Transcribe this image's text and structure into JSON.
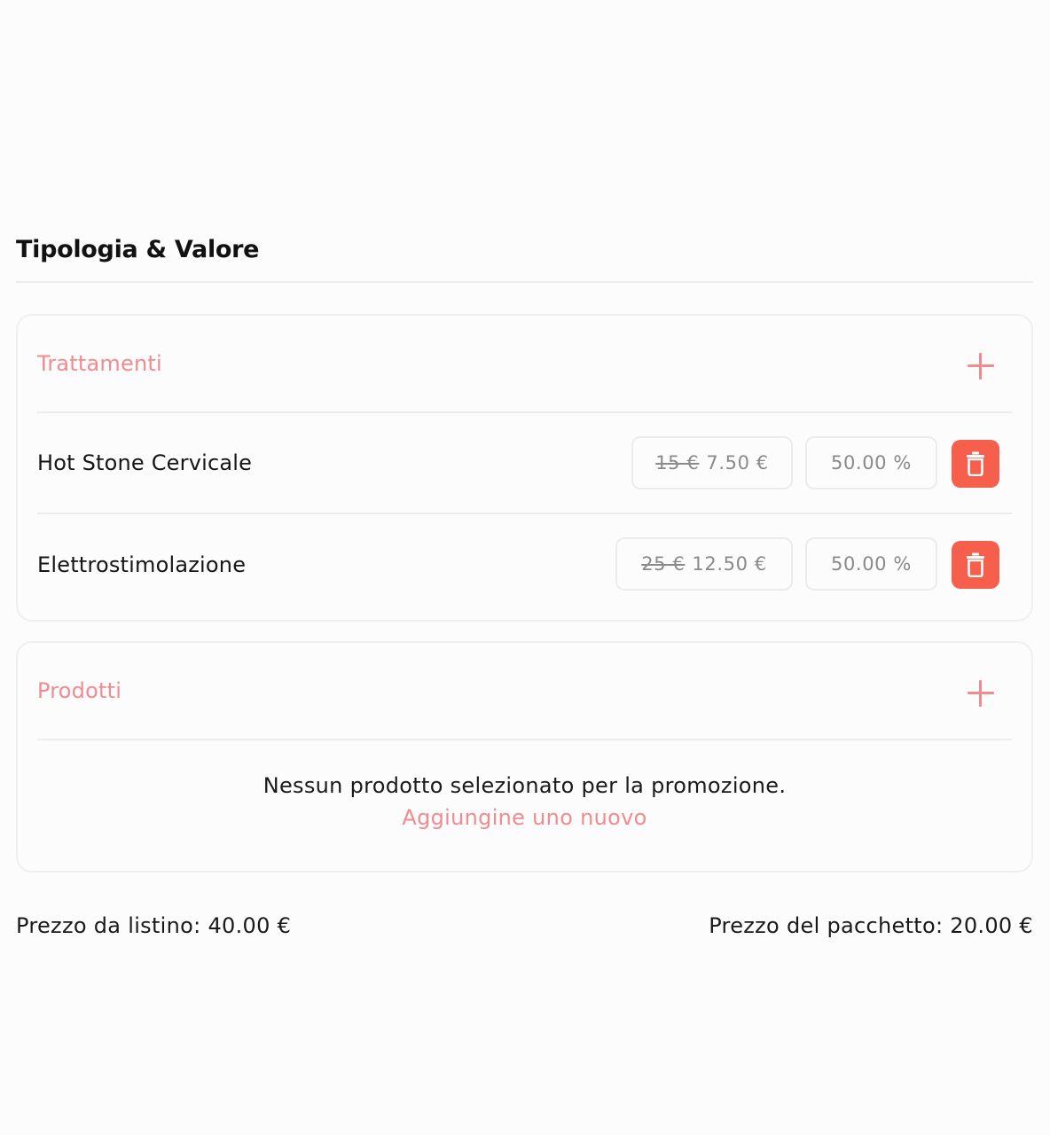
{
  "section": {
    "title": "Tipologia & Valore"
  },
  "treatments": {
    "title": "Trattamenti",
    "add_icon": "plus-icon",
    "items": [
      {
        "name": "Hot Stone Cervicale",
        "old_price": "15 €",
        "price": "7.50 €",
        "discount": "50.00 %",
        "delete_icon": "trash-icon"
      },
      {
        "name": "Elettrostimolazione",
        "old_price": "25 €",
        "price": "12.50 €",
        "discount": "50.00 %",
        "delete_icon": "trash-icon"
      }
    ]
  },
  "products": {
    "title": "Prodotti",
    "add_icon": "plus-icon",
    "empty_message": "Nessun prodotto selezionato per la promozione.",
    "empty_link": "Aggiungine uno nuovo"
  },
  "footer": {
    "list_price": "Prezzo da listino: 40.00 €",
    "package_price": "Prezzo del pacchetto: 20.00 €"
  },
  "colors": {
    "accent": "#f28b90",
    "danger": "#f55f4c",
    "border": "#efefef",
    "background": "#fcfcfc"
  }
}
